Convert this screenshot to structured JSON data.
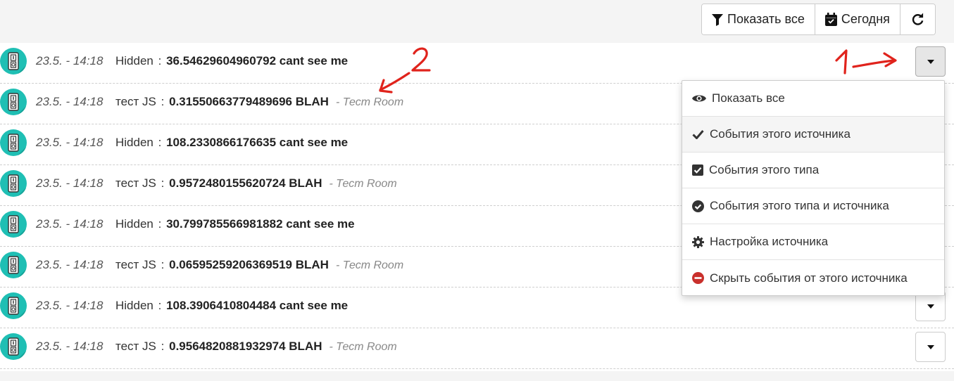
{
  "toolbar": {
    "show_all": "Показать все",
    "today": "Сегодня",
    "refresh_icon": "refresh-icon"
  },
  "events": [
    {
      "time": "23.5. - 14:18",
      "source": "Hidden",
      "value": "36.54629604960792 cant see me",
      "room": ""
    },
    {
      "time": "23.5. - 14:18",
      "source": "тест JS",
      "value": "0.31550663779489696 BLAH",
      "room": "- Тест Room"
    },
    {
      "time": "23.5. - 14:18",
      "source": "Hidden",
      "value": "108.2330866176635 cant see me",
      "room": ""
    },
    {
      "time": "23.5. - 14:18",
      "source": "тест JS",
      "value": "0.9572480155620724 BLAH",
      "room": "- Тест Room"
    },
    {
      "time": "23.5. - 14:18",
      "source": "Hidden",
      "value": "30.799785566981882 cant see me",
      "room": ""
    },
    {
      "time": "23.5. - 14:18",
      "source": "тест JS",
      "value": "0.06595259206369519 BLAH",
      "room": "- Тест Room"
    },
    {
      "time": "23.5. - 14:18",
      "source": "Hidden",
      "value": "108.3906410804484 cant see me",
      "room": ""
    },
    {
      "time": "23.5. - 14:18",
      "source": "тест JS",
      "value": "0.9564820881932974 BLAH",
      "room": "- Тест Room"
    }
  ],
  "separator": ":",
  "menu": {
    "items": [
      {
        "label": "Показать все",
        "icon": "eye-icon"
      },
      {
        "label": "События этого источника",
        "icon": "check-icon"
      },
      {
        "label": "События этого типа",
        "icon": "check-square-icon"
      },
      {
        "label": "События этого типа и источника",
        "icon": "check-circle-icon"
      },
      {
        "label": "Настройка источника",
        "icon": "gear-icon"
      },
      {
        "label": "Скрыть события от этого источника",
        "icon": "minus-circle-icon"
      }
    ]
  },
  "annotations": {
    "one": "1",
    "two": "2"
  },
  "colors": {
    "accent": "#1fbfb4",
    "annotation": "#e0231c",
    "hide": "#c9302c"
  }
}
